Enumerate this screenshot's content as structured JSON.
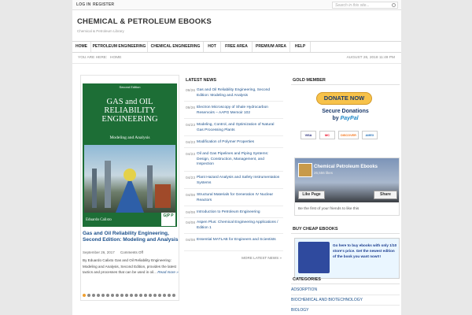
{
  "topbar": {
    "login": "LOG IN",
    "register": "REGISTER",
    "search_placeholder": "Search in this site..."
  },
  "site": {
    "title": "CHEMICAL & PETROLEUM EBOOKS",
    "tagline": "Chemical & Petroleum Library"
  },
  "nav": {
    "items": [
      {
        "label": "HOME"
      },
      {
        "label": "PETROLEUM ENGINEERING"
      },
      {
        "label": "CHEMICAL ENGINEERING"
      },
      {
        "label": "HOT"
      },
      {
        "label": "FREE AREA"
      },
      {
        "label": "PREMIUM AREA"
      },
      {
        "label": "HELP"
      }
    ]
  },
  "breadcrumb": {
    "prefix": "YOU ARE HERE:",
    "home": "HOME",
    "date": "AUGUST 26, 2018 11:49 PM"
  },
  "feature": {
    "cover_edition": "Second Edition",
    "cover_title": "GAS and OIL RELIABILITY ENGINEERING",
    "cover_subtitle": "Modeling and Analysis",
    "cover_author": "Eduardo Calixto",
    "cover_logo": "G|P P",
    "title": "Gas and Oil Reliability Engineering, Second Edition: Modeling and Analysis",
    "date": "September 26, 2017",
    "comments": "Comments Off",
    "excerpt": "By Eduardo Calixto Gas and Oil Reliability Engineering: Modeling and Analysis, Second Edition, provides the latest tactics and processes that can be used in oil...",
    "read_more": "Read more »"
  },
  "latest": {
    "heading": "LATEST NEWS",
    "items": [
      {
        "date": "09/26",
        "title": "Gas and Oil Reliability Engineering, Second Edition: Modeling and Analysis"
      },
      {
        "date": "09/26",
        "title": "Electron Microscopy of Shale Hydrocarbon Reservoirs – AAPG Memoir 102"
      },
      {
        "date": "04/23",
        "title": "Modeling, Control, and Optimization of Natural Gas Processing Plants"
      },
      {
        "date": "04/23",
        "title": "Modification of Polymer Properties"
      },
      {
        "date": "04/23",
        "title": "Oil and Gas Pipelines and Piping Systems: Design, Construction, Management, and Inspection"
      },
      {
        "date": "04/23",
        "title": "Plant Hazard Analysis and Safety Instrumentation Systems"
      },
      {
        "date": "04/08",
        "title": "Structural Materials for Generation IV Nuclear Reactors"
      },
      {
        "date": "04/08",
        "title": "Introduction to Petroleum Engineering"
      },
      {
        "date": "04/08",
        "title": "Aspen Plus: Chemical Engineering Applications / Edition 1"
      },
      {
        "date": "04/08",
        "title": "Essential MATLAB for Engineers and Scientists"
      }
    ],
    "more": "MORE LATEST NEWS »"
  },
  "gold": {
    "heading": "GOLD MEMBER",
    "donate": "DONATE NOW",
    "secure_line1": "Secure Donations",
    "secure_by": "by",
    "paypal": "PayPal",
    "cards": [
      {
        "label": "VISA",
        "color": "#1a1f71"
      },
      {
        "label": "MC",
        "color": "#eb001b"
      },
      {
        "label": "DISCOVER",
        "color": "#f47216"
      },
      {
        "label": "AMEX",
        "color": "#2e77bb"
      }
    ]
  },
  "facebook": {
    "name": "Chemical Petroleum Ebooks",
    "likes": "26,556 likes",
    "like_button": "Like Page",
    "share_button": "Share",
    "friends": "Be the first of your friends to like this"
  },
  "cheap": {
    "heading": "BUY CHEAP EBOOKS",
    "text": "Go here to buy ebooks with only 1/10 store's price. Get the newest edition of the book you want now!!!"
  },
  "categories": {
    "heading": "CATEGORIES",
    "items": [
      {
        "label": "ADSORPTION"
      },
      {
        "label": "BIOCHEMICAL AND BIOTECHNOLOGY"
      },
      {
        "label": "BIOLOGY"
      }
    ]
  },
  "colors": {
    "link": "#1a4f8b",
    "cover_green": "#1d6e36",
    "donate_gold": "#f7c24a"
  }
}
